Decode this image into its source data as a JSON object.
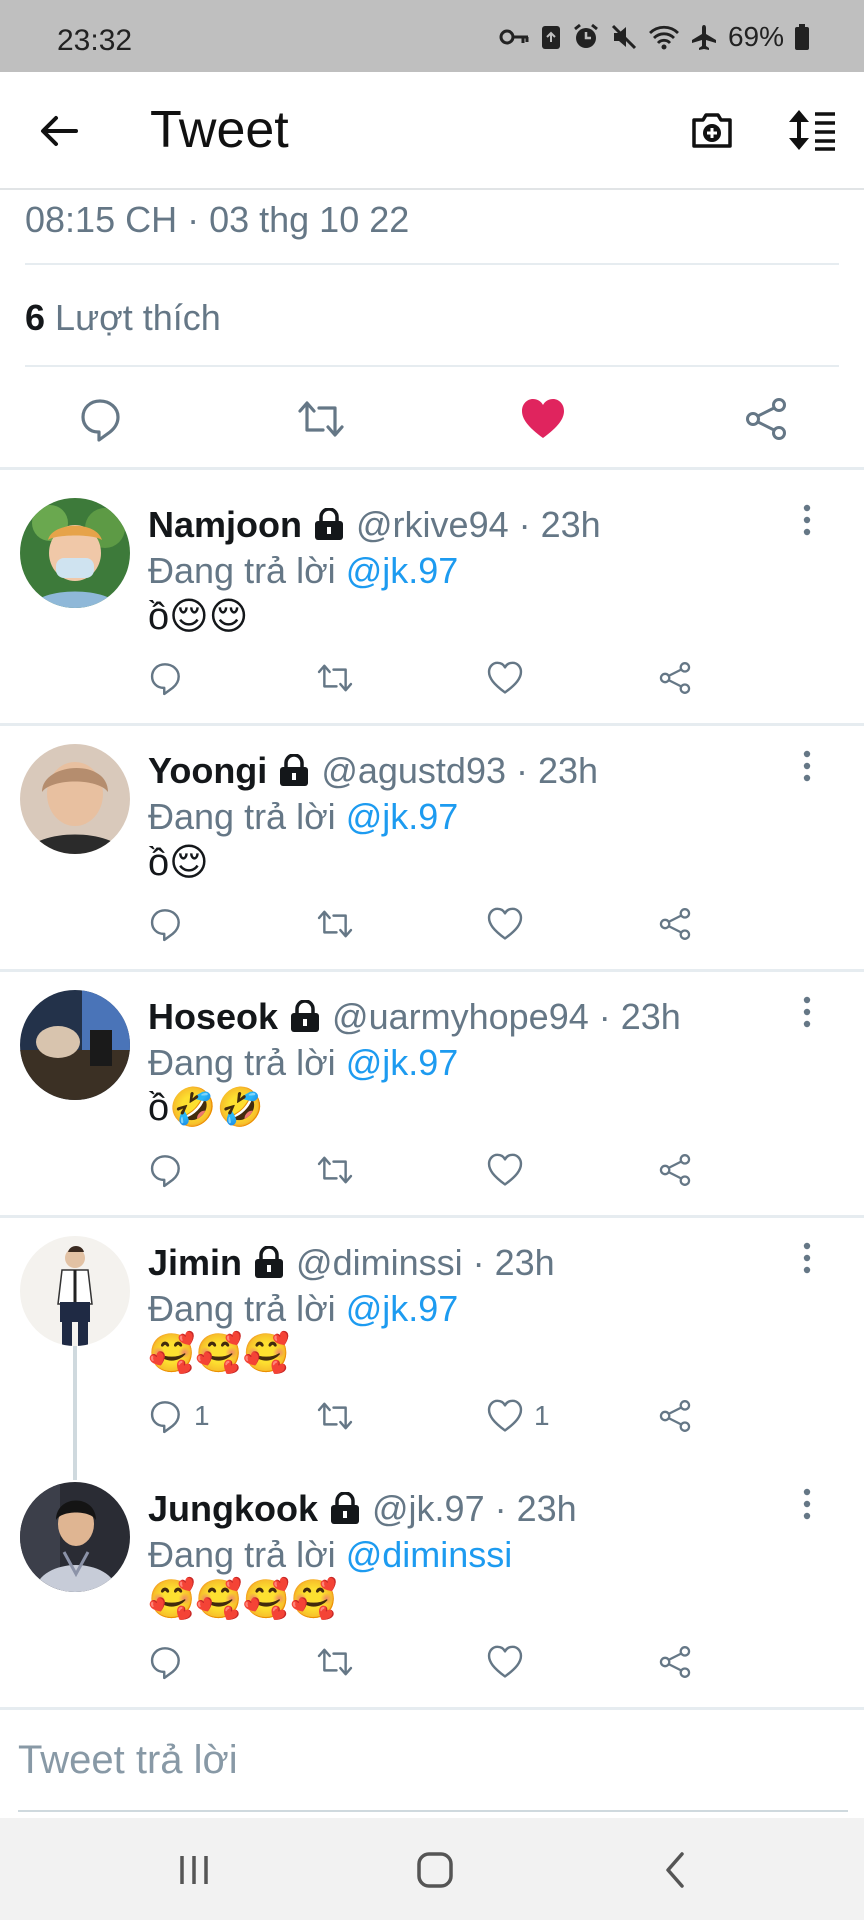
{
  "status_bar": {
    "time": "23:32",
    "battery": "69%",
    "icons": [
      "key-icon",
      "recycle-icon",
      "alarm-icon",
      "mute-icon",
      "wifi-icon",
      "airplane-icon",
      "battery-icon"
    ]
  },
  "header": {
    "title": "Tweet",
    "icons": [
      "back-arrow-icon",
      "camera-add-icon",
      "sort-icon"
    ]
  },
  "tweet_meta": {
    "timestamp": "08:15 CH · 03 thg 10 22",
    "likes_count": "6",
    "likes_label": "Lượt thích"
  },
  "action_bar": {
    "icons": [
      "reply-icon",
      "retweet-icon",
      "heart-filled-icon",
      "share-icon"
    ],
    "liked": true,
    "like_color": "#e0245e"
  },
  "replies": [
    {
      "name": "Namjoon",
      "handle": "@rkive94 · 23h",
      "replying_prefix": "Đang trả lời ",
      "replying_to": "@jk.97",
      "text": "ồ😌😌",
      "reply_count": "",
      "like_count": ""
    },
    {
      "name": "Yoongi",
      "handle": "@agustd93 · 23h",
      "replying_prefix": "Đang trả lời ",
      "replying_to": "@jk.97",
      "text": "ồ😌",
      "reply_count": "",
      "like_count": ""
    },
    {
      "name": "Hoseok",
      "handle": "@uarmyhope94 · 23h",
      "replying_prefix": "Đang trả lời ",
      "replying_to": "@jk.97",
      "text": "ồ🤣🤣",
      "reply_count": "",
      "like_count": ""
    },
    {
      "name": "Jimin",
      "handle": "@diminssi · 23h",
      "replying_prefix": "Đang trả lời ",
      "replying_to": "@jk.97",
      "text": "🥰🥰🥰",
      "reply_count": "1",
      "like_count": "1"
    },
    {
      "name": "Jungkook",
      "handle": "@jk.97 · 23h",
      "replying_prefix": "Đang trả lời ",
      "replying_to": "@diminssi",
      "text": "🥰🥰🥰🥰",
      "reply_count": "",
      "like_count": ""
    }
  ],
  "reply_box": {
    "placeholder": "Tweet trả lời"
  },
  "nav_bar": {
    "icons": [
      "recents-icon",
      "home-icon",
      "back-icon"
    ]
  }
}
